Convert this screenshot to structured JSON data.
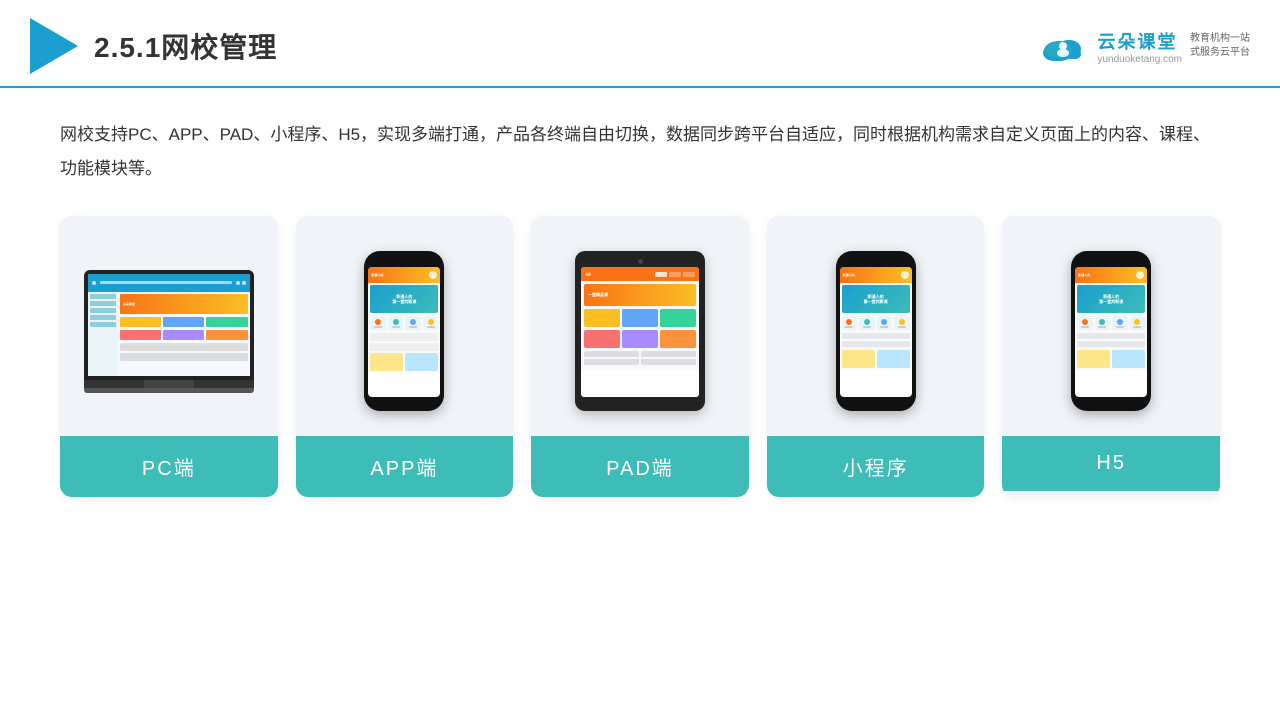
{
  "header": {
    "title": "2.5.1网校管理",
    "brand_name": "云朵课堂",
    "brand_url": "yunduoketang.com",
    "brand_tagline": "教育机构一站\n式服务云平台"
  },
  "description": "网校支持PC、APP、PAD、小程序、H5，实现多端打通，产品各终端自由切换，数据同步跨平台自适应，同时根据机构需求自定义页面上的内容、课程、功能模块等。",
  "cards": [
    {
      "id": "pc",
      "label": "PC端"
    },
    {
      "id": "app",
      "label": "APP端"
    },
    {
      "id": "pad",
      "label": "PAD端"
    },
    {
      "id": "miniapp",
      "label": "小程序"
    },
    {
      "id": "h5",
      "label": "H5"
    }
  ],
  "teal_color": "#3dbcb8",
  "blue_color": "#1a9fce"
}
